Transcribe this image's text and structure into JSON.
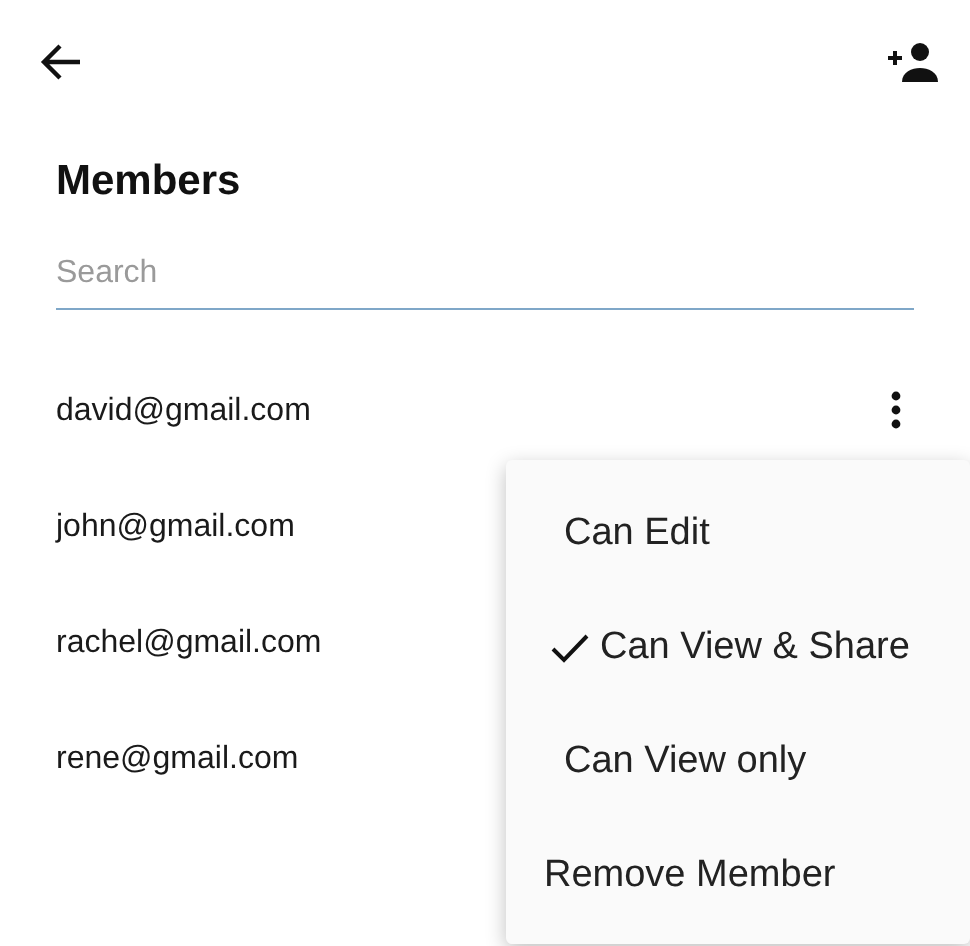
{
  "title": "Members",
  "search": {
    "placeholder": "Search"
  },
  "members": [
    {
      "email": "david@gmail.com",
      "menu_button": true
    },
    {
      "email": "john@gmail.com"
    },
    {
      "email": "rachel@gmail.com"
    },
    {
      "email": "rene@gmail.com"
    }
  ],
  "menu": {
    "items": [
      {
        "label": "Can Edit",
        "kind": "permission",
        "selected": false
      },
      {
        "label": "Can View & Share",
        "kind": "permission",
        "selected": true
      },
      {
        "label": "Can View only",
        "kind": "permission",
        "selected": false
      },
      {
        "label": "Remove Member",
        "kind": "action"
      }
    ]
  }
}
